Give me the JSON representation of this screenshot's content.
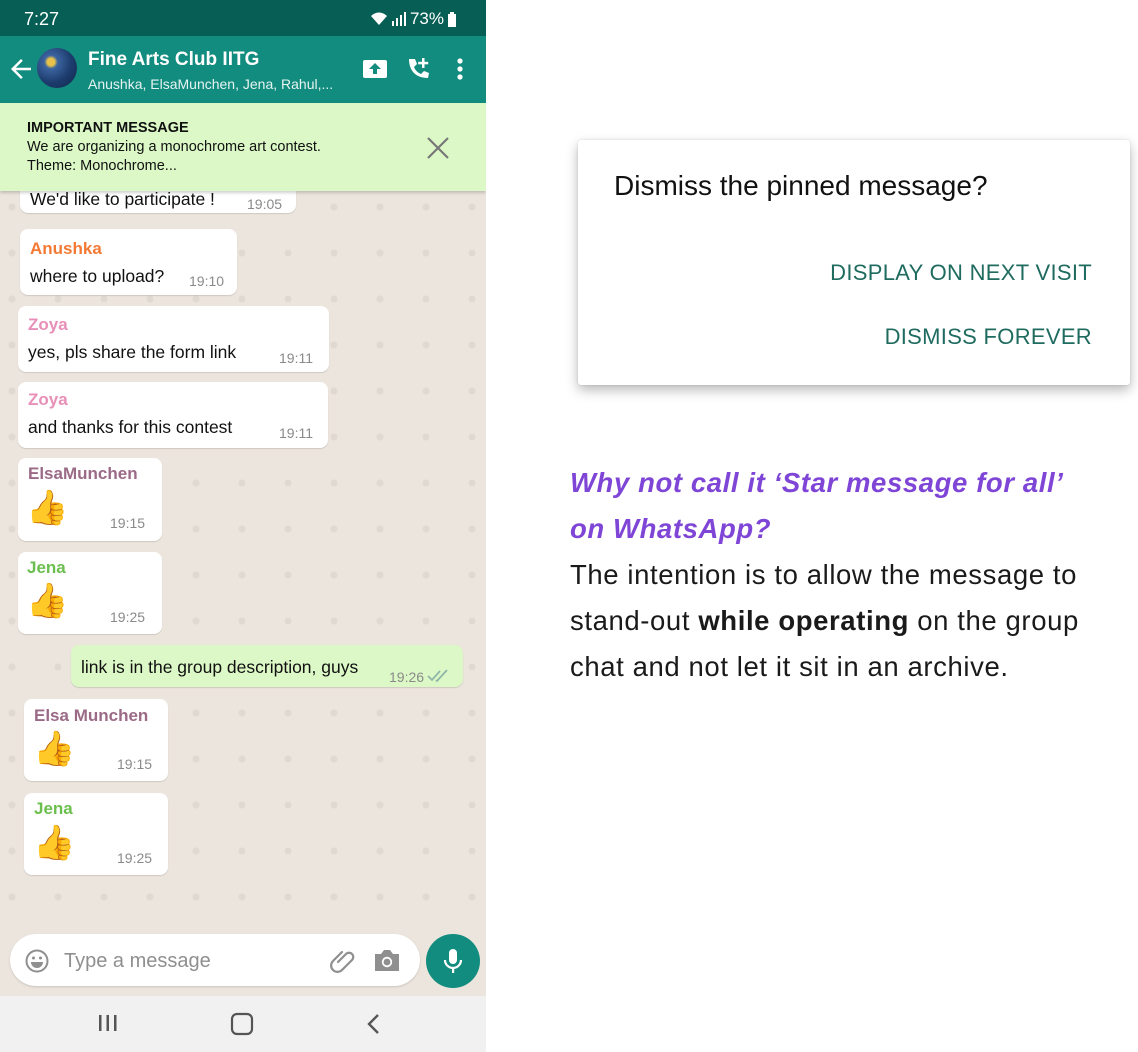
{
  "status_bar": {
    "time": "7:27",
    "battery": "73%"
  },
  "header": {
    "title": "Fine Arts Club IITG",
    "subtitle": "Anushka, ElsaMunchen, Jena, Rahul,..."
  },
  "pinned": {
    "heading": "IMPORTANT MESSAGE",
    "line1": "We are organizing a monochrome art contest.",
    "line2": "Theme: Monochrome..."
  },
  "messages": [
    {
      "text": "We'd like to participate !",
      "time": "19:05"
    },
    {
      "sender": "Anushka",
      "text": "where to upload?",
      "time": "19:10"
    },
    {
      "sender": "Zoya",
      "text": "yes, pls share the form link",
      "time": "19:11"
    },
    {
      "sender": "Zoya",
      "text": "and thanks for this contest",
      "time": "19:11"
    },
    {
      "sender": "ElsaMunchen",
      "emoji": "👍",
      "time": "19:15"
    },
    {
      "sender": "Jena",
      "emoji": "👍",
      "time": "19:25"
    },
    {
      "text": "link is in the group description, guys",
      "time": "19:26"
    },
    {
      "sender": "Elsa Munchen",
      "emoji": "👍",
      "time": "19:15"
    },
    {
      "sender": "Jena",
      "emoji": "👍",
      "time": "19:25"
    }
  ],
  "composer": {
    "placeholder": "Type a message"
  },
  "dialog": {
    "title": "Dismiss the pinned message?",
    "option1": "DISPLAY ON NEXT VISIT",
    "option2": "DISMISS FOREVER"
  },
  "note": {
    "question_line1": "Why not call it ‘Star message for all’",
    "question_line2": "on WhatsApp?",
    "body_before": "The intention is to allow the message to stand-out ",
    "body_bold": "while operating",
    "body_after": " on the group chat and not let it sit in an archive."
  },
  "colors": {
    "header_dark": "#075e54",
    "header": "#128c7e",
    "pinned_bg": "#dbf8c6",
    "outgoing_bubble": "#dcf8c6",
    "anushka": "#f47a34",
    "zoya": "#e88fb8",
    "elsa": "#9b6a86",
    "jena": "#6bbf4e",
    "dialog_button": "#1f6b5f",
    "question": "#7e45d6"
  },
  "icons": [
    "back-arrow-icon",
    "upload-icon",
    "add-call-icon",
    "more-vert-icon",
    "close-icon",
    "emoji-icon",
    "attach-icon",
    "camera-icon",
    "mic-icon",
    "double-check-icon",
    "recents-icon",
    "home-icon",
    "back-icon"
  ]
}
